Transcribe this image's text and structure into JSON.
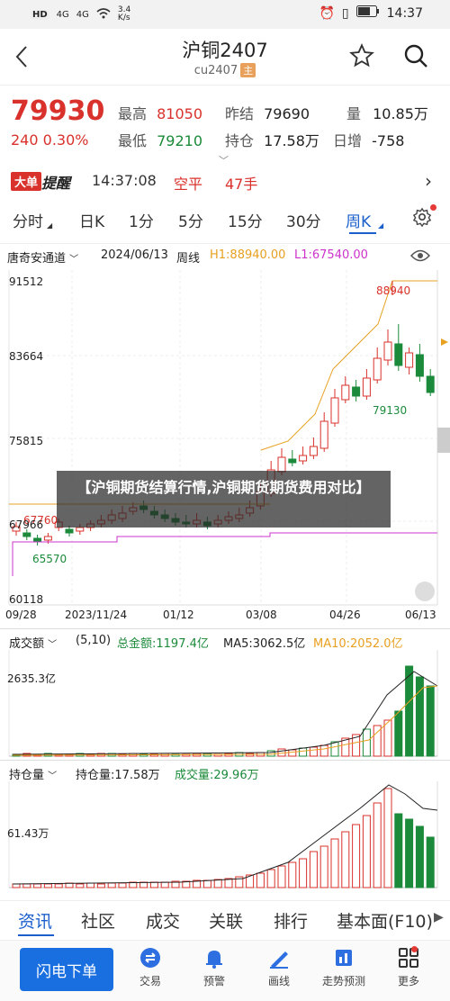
{
  "status_bar": {
    "hd1": "HD",
    "sig1": "4G",
    "sig2": "4G",
    "net_speed": "3.4\nK/s",
    "time": "14:37"
  },
  "header": {
    "title": "沪铜2407",
    "code": "cu2407",
    "main_badge": "主",
    "icons": [
      "back-icon",
      "star-icon",
      "search-icon"
    ]
  },
  "quote": {
    "price": "79930",
    "change": "240",
    "change_pct": "0.30%",
    "high_label": "最高",
    "high": "81050",
    "low_label": "最低",
    "low": "79210",
    "prev_settle_label": "昨结",
    "prev_settle": "79690",
    "open_int_label": "持仓",
    "open_int": "17.58万",
    "volume_label": "量",
    "volume": "10.85万",
    "day_inc_label": "日增",
    "day_inc": "-758"
  },
  "alert_bar": {
    "badge": "大单",
    "title": "提醒",
    "time": "14:37:08",
    "type": "空平",
    "qty": "47手"
  },
  "period_tabs": [
    "分时",
    "日K",
    "1分",
    "5分",
    "15分",
    "30分",
    "周K"
  ],
  "period_active": "周K",
  "chart_head": {
    "indicator": "唐奇安通道",
    "date": "2024/06/13",
    "period": "周线",
    "h1": "H1:88940.00",
    "l1": "L1:67540.00"
  },
  "chart_data": {
    "type": "candlestick",
    "y_ticks": [
      "91512",
      "83664",
      "75815",
      "67966",
      "60118"
    ],
    "x_ticks": [
      "09/28",
      "2023/11/24",
      "01/12",
      "03/08",
      "04/26",
      "06/13"
    ],
    "annotations": {
      "high": "88940",
      "low": "65570",
      "last": "79130",
      "left_mark": "67760"
    },
    "td_numbers": [
      "4",
      "5",
      "6",
      "7",
      "2",
      "3",
      "4",
      "5",
      "6",
      "7",
      "8",
      "9",
      "1",
      "2",
      "3",
      "4",
      "5",
      "6",
      "7",
      "8",
      "9"
    ],
    "volume": {
      "header_label": "成交额",
      "params": "(5,10)",
      "total_label": "总金额:1197.4亿",
      "ma5": "MA5:3062.5亿",
      "ma10": "MA10:2052.0亿",
      "y_label": "2635.3亿"
    },
    "open_interest": {
      "header_label": "持仓量",
      "oi_label": "持仓量:17.58万",
      "vol_label": "成交量:29.96万",
      "y_label": "61.43万"
    }
  },
  "overlay": {
    "text": "【沪铜期货结算行情,沪铜期货期货费用对比】"
  },
  "section_tabs": [
    "资讯",
    "社区",
    "成交",
    "关联",
    "排行",
    "基本面(F10)"
  ],
  "section_active": "资讯",
  "bottom_nav": {
    "flash": "闪电下单",
    "items": [
      "交易",
      "预警",
      "画线",
      "走势预测",
      "更多"
    ]
  },
  "colors": {
    "up": "#d9312b",
    "down": "#1b8a3a",
    "accent": "#1a5fcc",
    "h1": "#e8a020",
    "l1": "#cc33cc"
  }
}
